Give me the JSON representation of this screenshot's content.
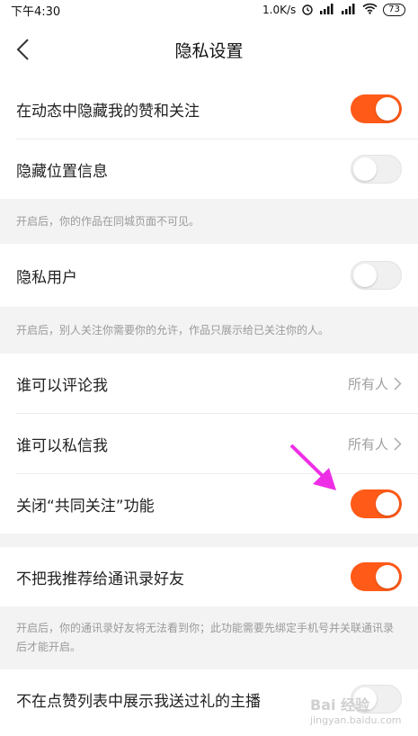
{
  "status_bar": {
    "time": "下午4:30",
    "speed": "1.0K/s",
    "battery": "73"
  },
  "nav": {
    "title": "隐私设置"
  },
  "settings": [
    {
      "label": "在动态中隐藏我的赞和关注",
      "toggle": "on"
    },
    {
      "label": "隐藏位置信息",
      "toggle": "off"
    },
    {
      "label": "隐私用户",
      "toggle": "off"
    },
    {
      "label": "谁可以评论我",
      "value": "所有人"
    },
    {
      "label": "谁可以私信我",
      "value": "所有人"
    },
    {
      "label": "关闭“共同关注”功能",
      "toggle": "on"
    },
    {
      "label": "不把我推荐给通讯录好友",
      "toggle": "on"
    },
    {
      "label": "不在点赞列表中展示我送过礼的主播",
      "toggle": "off"
    }
  ],
  "notes": {
    "location": "开启后，你的作品在同城页面不可见。",
    "private_user": "开启后，别人关注你需要你的允许，作品只展示给已关注你的人。",
    "contacts": "开启后，你的通讯录好友将无法看到你；此功能需要先绑定手机号并关联通讯录后才能开启。"
  },
  "watermark": {
    "brand": "Bai 经验",
    "url": "jingyan.baidu.com"
  },
  "colors": {
    "accent": "#ff5a17",
    "annotation_arrow": "#ee2ee6"
  }
}
